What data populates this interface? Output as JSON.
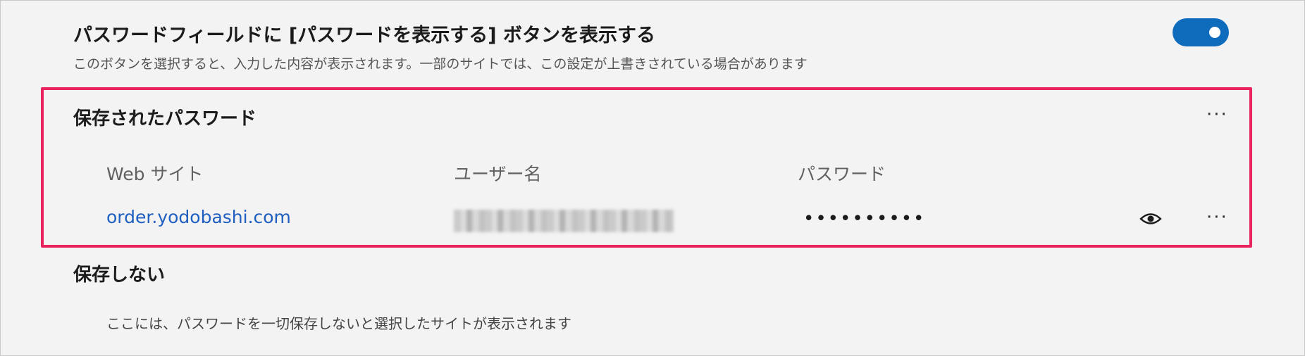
{
  "show_password_setting": {
    "title": "パスワードフィールドに [パスワードを表示する] ボタンを表示する",
    "description": "このボタンを選択すると、入力した内容が表示されます。一部のサイトでは、この設定が上書きされている場合があります",
    "toggle_on": true,
    "accent_color": "#0f6cbd"
  },
  "saved_passwords": {
    "title": "保存されたパスワード",
    "more_label": "···",
    "columns": {
      "website": "Web サイト",
      "username": "ユーザー名",
      "password": "パスワード"
    },
    "rows": [
      {
        "website": "order.yodobashi.com",
        "username_blurred": true,
        "password_masked": "••••••••••",
        "reveal_icon": "eye-icon",
        "more_label": "···"
      }
    ],
    "highlight_color": "#e8235e"
  },
  "never_saved": {
    "title": "保存しない",
    "empty_text": "ここには、パスワードを一切保存しないと選択したサイトが表示されます"
  }
}
